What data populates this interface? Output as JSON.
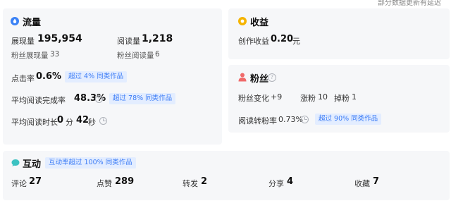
{
  "top_note": "部分数据更新有延迟",
  "traffic": {
    "title": "流量",
    "icon": "droplet-icon",
    "impressions_label": "展现量",
    "impressions_value": "195,954",
    "reads_label": "阅读量",
    "reads_value": "1,218",
    "fan_impressions_label": "粉丝展现量",
    "fan_impressions_value": "33",
    "fan_reads_label": "粉丝阅读量",
    "fan_reads_value": "6",
    "ctr_label": "点击率",
    "ctr_value": "0.6%",
    "ctr_tag": "超过 4% 同类作品",
    "completion_label": "平均阅读完成率",
    "completion_value": "48.3%",
    "completion_tag": "超过 78% 同类作品",
    "duration_label": "平均阅读时长",
    "duration_min_value": "0",
    "duration_min_unit": "分",
    "duration_sec_value": "42",
    "duration_sec_unit": "秒"
  },
  "income": {
    "title": "收益",
    "icon": "coin-icon",
    "label": "创作收益",
    "value": "0.20",
    "unit": "元"
  },
  "fans": {
    "title": "粉丝",
    "icon": "user-icon",
    "change_label": "粉丝变化",
    "change_value": "+9",
    "gain_label": "涨粉",
    "gain_value": "10",
    "loss_label": "掉粉",
    "loss_value": "1",
    "conversion_label": "阅读转粉率",
    "conversion_value": "0.73%",
    "conversion_tag": "超过 90% 同类作品"
  },
  "interaction": {
    "title": "互动",
    "icon": "chat-bubble-icon",
    "tag": "互动率超过 100% 同类作品",
    "comments_label": "评论",
    "comments_value": "27",
    "likes_label": "点赞",
    "likes_value": "289",
    "reposts_label": "转发",
    "reposts_value": "2",
    "shares_label": "分享",
    "shares_value": "4",
    "favorites_label": "收藏",
    "favorites_value": "7"
  },
  "colors": {
    "card_bg": "#f6f7f9",
    "tag_bg": "#e3edff",
    "tag_text": "#3a7bf6",
    "traffic_icon": "#3b82f6",
    "income_icon": "#f5b400",
    "fans_icon": "#f06a6a",
    "interaction_icon": "#3cc2c2"
  }
}
